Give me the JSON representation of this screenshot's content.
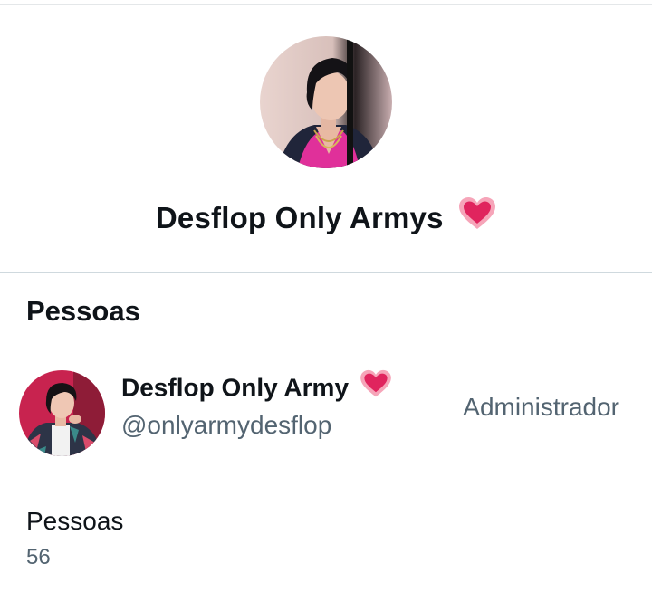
{
  "group": {
    "name": "Desflop Only Armys",
    "emoji": "heart-icon"
  },
  "people_section": {
    "title": "Pessoas"
  },
  "members": [
    {
      "display_name": "Desflop Only Army",
      "handle": "@onlyarmydesflop",
      "role": "Administrador",
      "emoji": "heart-icon"
    }
  ],
  "stats": {
    "label": "Pessoas",
    "value": "56"
  },
  "colors": {
    "text_primary": "#0f1419",
    "text_secondary": "#536471",
    "divider": "#cfd9de",
    "heart": "#e0245e"
  }
}
